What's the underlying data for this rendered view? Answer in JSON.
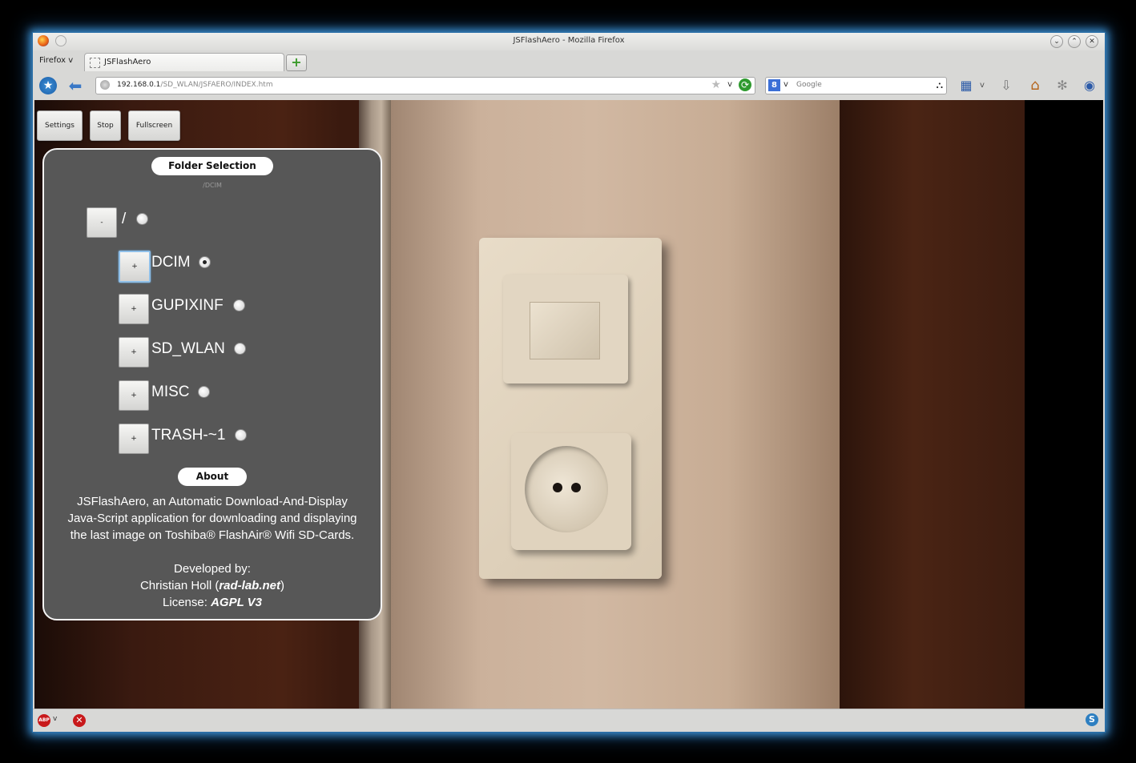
{
  "window": {
    "title": "JSFlashAero - Mozilla Firefox",
    "menu_label": "Firefox",
    "menu_chevron": "v"
  },
  "tab": {
    "label": "JSFlashAero",
    "new_tab_symbol": "+"
  },
  "nav": {
    "url_host": "192.168.0.1",
    "url_path": "/SD_WLAN/JSFAERO/INDEX.htm",
    "search_placeholder": "Google",
    "search_engine_glyph": "8",
    "dropdown_glyph": "v",
    "star_glyph": "★",
    "back_glyph": "⬅",
    "reload_glyph": "⟳",
    "binoculars_glyph": "⛬",
    "bookmarks_glyph": "▦",
    "download_glyph": "⇩",
    "home_glyph": "⌂",
    "addon_glyph": "✻",
    "sync_glyph": "◉"
  },
  "toolbar": {
    "settings_label": "Settings",
    "stop_label": "Stop",
    "fullscreen_label": "Fullscreen"
  },
  "folder_panel": {
    "heading": "Folder Selection",
    "current_path": "/DCIM",
    "root": {
      "button": "-",
      "label": "/",
      "selected": false
    },
    "folders": [
      {
        "button": "+",
        "label": "DCIM",
        "selected": true
      },
      {
        "button": "+",
        "label": "GUPIXINF",
        "selected": false
      },
      {
        "button": "+",
        "label": "SD_WLAN",
        "selected": false
      },
      {
        "button": "+",
        "label": "MISC",
        "selected": false
      },
      {
        "button": "+",
        "label": "TRASH-~1",
        "selected": false
      }
    ]
  },
  "about": {
    "heading": "About",
    "line1": "JSFlashAero, an Automatic Download-And-Display",
    "line2": "Java-Script application for downloading and displaying",
    "line3": "the last image on Toshiba® FlashAir® Wifi SD-Cards.",
    "developed_by": "Developed by:",
    "author_prefix": "Christian Holl (",
    "author_link": "rad-lab.net",
    "author_suffix": ")",
    "license_prefix": "License: ",
    "license": "AGPL V3"
  },
  "statusbar": {
    "adblock_label": "ABP",
    "adblock_drop": "v",
    "stop_glyph": "✕",
    "skype_glyph": "S"
  },
  "icons": [
    "firefox-icon",
    "star-icon",
    "back-arrow-icon",
    "globe-icon",
    "bookmark-star-icon",
    "reload-icon",
    "google-icon",
    "binoculars-icon",
    "bookmarks-icon",
    "download-icon",
    "home-icon",
    "addon-icon",
    "sync-icon",
    "adblock-icon",
    "stop-icon",
    "skype-icon"
  ]
}
